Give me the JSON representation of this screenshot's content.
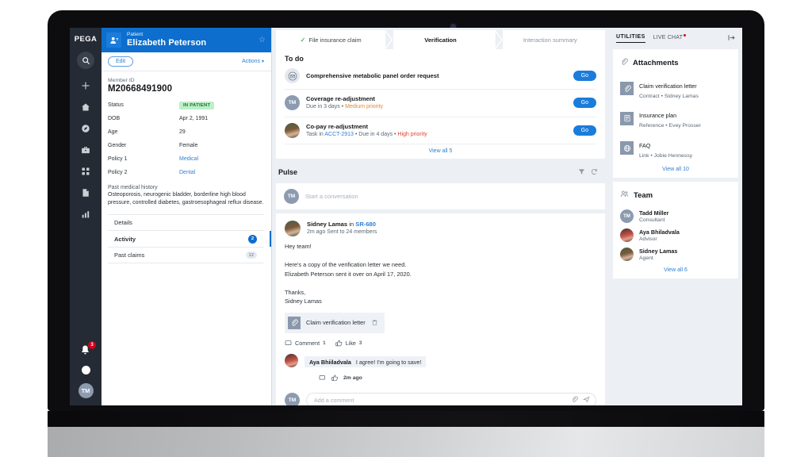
{
  "brand": "PEGA",
  "left_rail": {
    "icons": [
      "search-icon",
      "plus-icon",
      "home-icon",
      "compass-icon",
      "briefcase-icon",
      "grid-icon",
      "document-icon",
      "chart-icon"
    ],
    "notification_count": "3",
    "avatar_initials": "TM"
  },
  "patient": {
    "kicker": "Patient",
    "name": "Elizabeth Peterson",
    "edit_label": "Edit",
    "actions_label": "Actions",
    "actions_caret": "▾",
    "star_icon": "star-outline-icon",
    "member_id_label": "Member ID",
    "member_id_value": "M20668491900",
    "fields": [
      {
        "key": "Status",
        "value": "IN PATIENT",
        "type": "badge"
      },
      {
        "key": "DOB",
        "value": "Apr 2, 1991",
        "type": "text"
      },
      {
        "key": "Age",
        "value": "29",
        "type": "text"
      },
      {
        "key": "Gender",
        "value": "Female",
        "type": "text"
      },
      {
        "key": "Policy 1",
        "value": "Medical",
        "type": "link"
      },
      {
        "key": "Policy 2",
        "value": "Dental",
        "type": "link"
      }
    ],
    "history_title": "Past medical history",
    "history_text": "Osteoporosis, neurogenic bladder, borderline high blood pressure, controlled diabetes, gastroesophageal reflux disease.",
    "nav": [
      {
        "label": "Details",
        "count": "",
        "count_style": "none",
        "active": false
      },
      {
        "label": "Activity",
        "count": "2",
        "count_style": "blue",
        "active": true
      },
      {
        "label": "Past claims",
        "count": "12",
        "count_style": "gray",
        "active": false
      }
    ]
  },
  "stages": [
    {
      "label": "File insurance claim",
      "state": "done"
    },
    {
      "label": "Verification",
      "state": "current"
    },
    {
      "label": "Interaction summary",
      "state": "upcoming"
    }
  ],
  "todo": {
    "title": "To do",
    "view_all": "View all 5",
    "items": [
      {
        "title": "Comprehensive metabolic panel order request",
        "sub_parts": [],
        "avatar_type": "envelope",
        "avatar_text": "",
        "button": "Go"
      },
      {
        "title": "Coverage re-adjustment",
        "sub_parts": [
          {
            "text": "Due in 3 days",
            "style": "plain"
          },
          {
            "text": " • ",
            "style": "plain"
          },
          {
            "text": "Medium priority",
            "style": "med"
          }
        ],
        "avatar_type": "initials",
        "avatar_text": "TM",
        "button": "Go"
      },
      {
        "title": "Co-pay re-adjustment",
        "sub_parts": [
          {
            "text": "Task in ",
            "style": "plain"
          },
          {
            "text": "ACCT-2913",
            "style": "lnk"
          },
          {
            "text": " • Due in 4 days • ",
            "style": "plain"
          },
          {
            "text": "High priority",
            "style": "high"
          }
        ],
        "avatar_type": "photo-a",
        "avatar_text": "",
        "button": "Go"
      }
    ]
  },
  "pulse": {
    "title": "Pulse",
    "filter_icon": "filter-icon",
    "refresh_icon": "refresh-icon",
    "composer_avatar": "TM",
    "composer_placeholder": "Start a conversation",
    "post": {
      "author": "Sidney Lamas",
      "in_word": "in",
      "case_ref": "SR-680",
      "meta": "2m ago Sent to 24 members",
      "body": "Hey team!\n\nHere's a copy of the verification letter we need.\nElizabeth Peterson sent it over on April 17, 2020.\n\nThanks,\nSidney Lamas",
      "attachment": "Claim verification letter",
      "attachment_icon": "paperclip-icon",
      "delete_icon": "trash-icon",
      "comment_label": "Comment",
      "comment_count": "1",
      "like_label": "Like",
      "like_count": "3",
      "comment": {
        "author": "Aya Bhiiladvala",
        "text": "I agree! I'm going to save!",
        "time": "2m ago"
      },
      "add_comment_avatar": "TM",
      "add_comment_placeholder": "Add a comment",
      "attach_icon": "paperclip-icon",
      "send_icon": "send-icon"
    }
  },
  "utilities": {
    "tabs": [
      {
        "label": "UTILITIES",
        "active": true,
        "dot": false
      },
      {
        "label": "LIVE CHAT",
        "active": false,
        "dot": true
      }
    ],
    "collapse_icon": "collapse-right-icon",
    "attachments": {
      "title": "Attachments",
      "header_icon": "paperclip-icon",
      "view_all": "View all 10",
      "items": [
        {
          "title": "Claim verification letter",
          "sub": "Contract • Sidney Lamas",
          "icon": "paperclip-icon"
        },
        {
          "title": "Insurance plan",
          "sub": "Reference • Evey Prosser",
          "icon": "document-lines-icon"
        },
        {
          "title": "FAQ",
          "sub": "Link • Jobie Hennessy",
          "icon": "globe-icon"
        }
      ]
    },
    "team": {
      "title": "Team",
      "header_icon": "people-icon",
      "view_all": "View all 6",
      "members": [
        {
          "name": "Tadd Miller",
          "role": "Consultant",
          "avatar_type": "initials",
          "avatar_text": "TM"
        },
        {
          "name": "Aya Bhiladvala",
          "role": "Advisor",
          "avatar_type": "photo-b",
          "avatar_text": ""
        },
        {
          "name": "Sidney Lamas",
          "role": "Agent",
          "avatar_type": "photo-a",
          "avatar_text": ""
        }
      ]
    }
  },
  "colors": {
    "brand_blue": "#0d6ecd",
    "accent_blue": "#1a7cdb",
    "link_blue": "#2f7fd1",
    "rail_dark": "#252b35",
    "app_bg": "#eceff3",
    "badge_green_bg": "#bdf0c7",
    "badge_green_text": "#1d6b34",
    "priority_medium": "#e08a2e",
    "priority_high": "#e0452e",
    "notification_red": "#d0021b"
  }
}
